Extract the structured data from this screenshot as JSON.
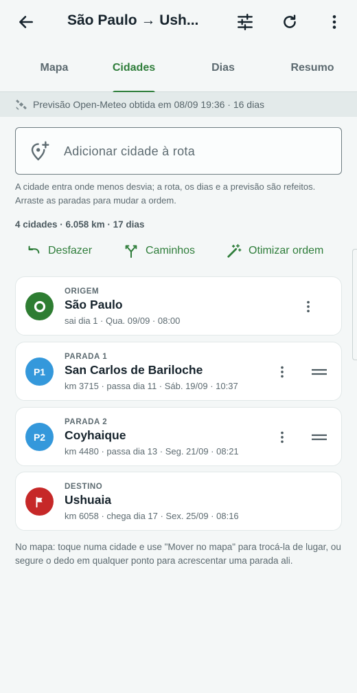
{
  "appbar": {
    "title": "São Paulo → Ush...",
    "back_icon": "arrow-left-icon",
    "filter_icon": "tune-sliders-icon",
    "refresh_icon": "refresh-icon",
    "menu_icon": "more-vertical-icon"
  },
  "tabs": [
    {
      "label": "Mapa",
      "active": false
    },
    {
      "label": "Cidades",
      "active": true
    },
    {
      "label": "Dias",
      "active": false
    },
    {
      "label": "Resumo",
      "active": false
    }
  ],
  "banner": {
    "icon": "satellite-icon",
    "text": "Previsão Open-Meteo obtida em 08/09 19:36 · 16 dias"
  },
  "add_city": {
    "icon": "add-location-icon",
    "placeholder": "Adicionar cidade à rota"
  },
  "hint": "A cidade entra onde menos desvia; a rota, os dias e a previsão são refeitos. Arraste as paradas para mudar a ordem.",
  "summary": "4 cidades · 6.058 km · 17 dias",
  "actions": {
    "undo": "Desfazer",
    "routes": "Caminhos",
    "optimize": "Otimizar ordem"
  },
  "stops": [
    {
      "kind": "ORIGEM",
      "name": "São Paulo",
      "meta": "sai dia 1 · Qua. 09/09 · 08:00",
      "badge": "",
      "color": "#2e7d32",
      "type": "origin"
    },
    {
      "kind": "PARADA 1",
      "name": "San Carlos de Bariloche",
      "meta": "km 3715 · passa dia 11 · Sáb. 19/09 · 10:37",
      "badge": "P1",
      "color": "#3498db",
      "type": "stop"
    },
    {
      "kind": "PARADA 2",
      "name": "Coyhaique",
      "meta": "km 4480 · passa dia 13 · Seg. 21/09 · 08:21",
      "badge": "P2",
      "color": "#3498db",
      "type": "stop"
    },
    {
      "kind": "DESTINO",
      "name": "Ushuaia",
      "meta": "km 6058 · chega dia 17 · Sex. 25/09 · 08:16",
      "badge": "",
      "color": "#c62828",
      "type": "destination"
    }
  ],
  "footer_hint": "No mapa: toque numa cidade e use \"Mover no mapa\" para trocá-la de lugar, ou segure o dedo em qualquer ponto para acrescentar uma parada ali.",
  "colors": {
    "accent": "#2e7d3a",
    "origin": "#2e7d32",
    "stop": "#3498db",
    "destination": "#c62828"
  }
}
